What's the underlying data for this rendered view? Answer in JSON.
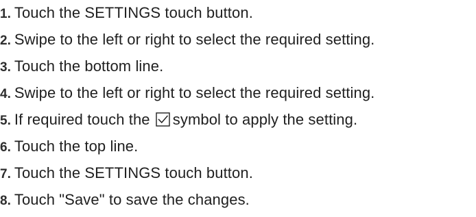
{
  "steps": [
    {
      "num": "1.",
      "text": "Touch the SETTINGS touch button."
    },
    {
      "num": "2.",
      "text": "Swipe to the left or right to select the required setting."
    },
    {
      "num": "3.",
      "text": "Touch the bottom line."
    },
    {
      "num": "4.",
      "text": "Swipe to the left or right to select the required setting."
    },
    {
      "num": "5.",
      "text_before_icon": "If required touch the",
      "icon": "checkbox-check-icon",
      "text_after_icon": "symbol to apply the setting."
    },
    {
      "num": "6.",
      "text": "Touch the top line."
    },
    {
      "num": "7.",
      "text": "Touch the SETTINGS touch button."
    },
    {
      "num": "8.",
      "text": "Touch \"Save\" to save the changes."
    }
  ]
}
